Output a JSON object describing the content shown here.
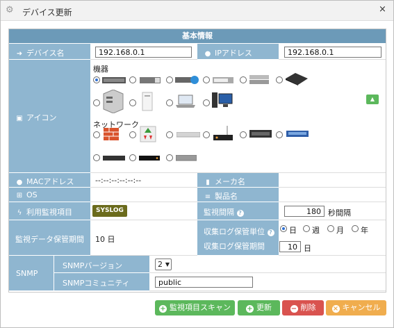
{
  "window": {
    "title": "デバイス更新",
    "close_label": "×"
  },
  "section_title": "基本情報",
  "device_name": {
    "label": "デバイス名",
    "value": "192.168.0.1"
  },
  "ip_address": {
    "label": "IPアドレス",
    "value": "192.168.0.1"
  },
  "icon": {
    "label": "アイコン",
    "group_equipment": "機器",
    "group_network": "ネットワーク",
    "selected": "server-rack-1",
    "equipment_icons": [
      "server-rack-1",
      "server-rack-2",
      "server-globe",
      "server-rack-3",
      "server-rack-4",
      "server-dark-box",
      "server-tower-gray",
      "server-tower-white",
      "laptop",
      "desktop-pc"
    ],
    "network_icons": [
      "firewall",
      "router-arrows",
      "switch-light",
      "wireless-router",
      "switch-dark",
      "switch-blue",
      "switch-small",
      "router-black",
      "switch-gray"
    ]
  },
  "mac_address": {
    "label": "MACアドレス",
    "value": "--:--:--:--:--:--"
  },
  "maker_name": {
    "label": "メーカ名",
    "value": ""
  },
  "os": {
    "label": "OS",
    "value": ""
  },
  "product_name": {
    "label": "製品名",
    "value": ""
  },
  "monitoring_items": {
    "label": "利用監視項目",
    "badge": "SYSLOG"
  },
  "monitoring_interval": {
    "label": "監視間隔",
    "value": "180",
    "unit": "秒間隔"
  },
  "retention": {
    "label": "監視データ保管期間",
    "value": "10 日"
  },
  "log_unit": {
    "label": "収集ログ保管単位",
    "options": [
      "日",
      "週",
      "月",
      "年"
    ],
    "selected": "日"
  },
  "log_period": {
    "label": "収集ログ保管期間",
    "value": "10",
    "unit": "日"
  },
  "snmp": {
    "label": "SNMP",
    "version_label": "SNMPバージョン",
    "version_value": "2",
    "community_label": "SNMPコミュニティ",
    "community_value": "public"
  },
  "buttons": {
    "scan": "監視項目スキャン",
    "update": "更新",
    "delete": "削除",
    "cancel": "キャンセル"
  },
  "colors": {
    "header": "#6c9ab8",
    "label_bg": "#8fb6d0",
    "scan": "#5cb85c",
    "update": "#5cb85c",
    "delete": "#d9534f",
    "cancel": "#f0ad4e",
    "syslog_badge": "#6b6b1c"
  }
}
